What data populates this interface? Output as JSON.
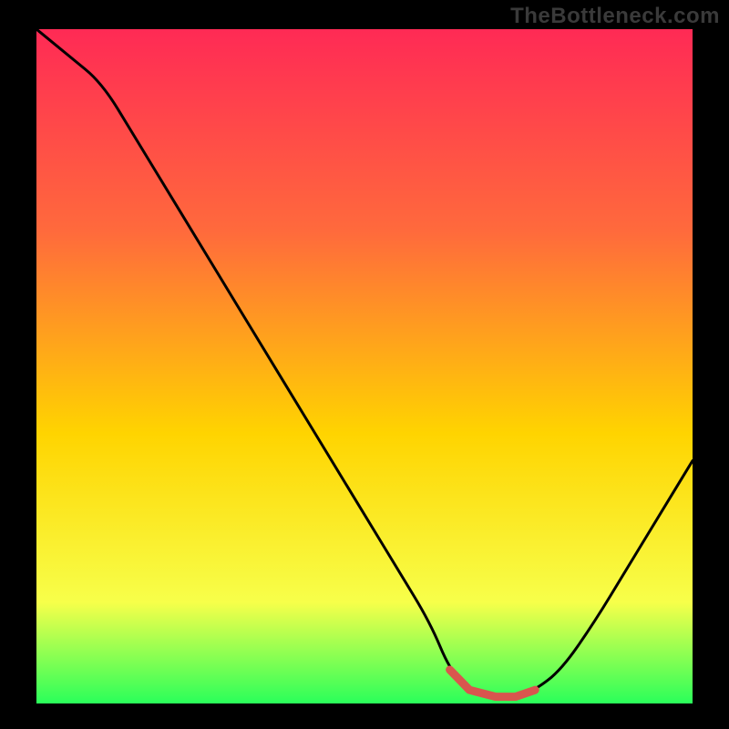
{
  "watermark": "TheBottleneck.com",
  "colors": {
    "page_bg": "#000000",
    "gradient_top": "#ff2a55",
    "gradient_mid1": "#ff6a3c",
    "gradient_mid2": "#ffd400",
    "gradient_mid3": "#f7ff4a",
    "gradient_bottom": "#2aff5a",
    "curve": "#000000",
    "highlight": "#d9554e"
  },
  "chart_data": {
    "type": "line",
    "title": "",
    "xlabel": "",
    "ylabel": "",
    "xlim": [
      0,
      100
    ],
    "ylim": [
      0,
      100
    ],
    "x": [
      0,
      5,
      10,
      15,
      20,
      25,
      30,
      35,
      40,
      45,
      50,
      55,
      60,
      63,
      66,
      70,
      73,
      76,
      80,
      85,
      90,
      95,
      100
    ],
    "values": [
      100,
      96,
      92,
      84,
      76,
      68,
      60,
      52,
      44,
      36,
      28,
      20,
      12,
      5,
      2,
      1,
      1,
      2,
      5,
      12,
      20,
      28,
      36
    ],
    "highlight_range_x": [
      63,
      78
    ],
    "gradient_stops": [
      {
        "offset": 0.0,
        "color": "#ff2a55"
      },
      {
        "offset": 0.3,
        "color": "#ff6a3c"
      },
      {
        "offset": 0.6,
        "color": "#ffd400"
      },
      {
        "offset": 0.85,
        "color": "#f7ff4a"
      },
      {
        "offset": 1.0,
        "color": "#2aff5a"
      }
    ]
  }
}
